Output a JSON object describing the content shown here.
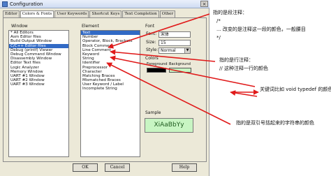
{
  "window": {
    "title": "Configuration",
    "close_label": "×"
  },
  "tabs": [
    "Editor",
    "Colors & Fonts",
    "User Keywords",
    "Shortcut Keys",
    "Text Completion",
    "Other"
  ],
  "window_group": {
    "label": "Window",
    "items": [
      "* All Editors",
      "Asm Editor files",
      "Build Output Window",
      "C/C++ Editor files",
      "Debug (printf) Viewer",
      "Debug Command Window",
      "Disassembly Window",
      "Editor Text files",
      "Logic Analyzer",
      "Memory Window",
      "UART #1 Window",
      "UART #2 Window",
      "UART #3 Window"
    ],
    "selected_index": 3
  },
  "element_group": {
    "label": "Element",
    "items": [
      "Text",
      "Number",
      "Operator, Block, Brackets",
      "Block Comment",
      "Line Comment",
      "Keyword",
      "String",
      "Identifier",
      "Preprocessor",
      "Character",
      "Matching Braces",
      "Mismatched Braces",
      "User Keyword / Label",
      "Incomplete String"
    ],
    "selected_index": 0
  },
  "font_group": {
    "label": "Font",
    "font_label": "Font:",
    "font_value": "宋体",
    "size_label": "Size:",
    "size_value": "15",
    "style_label": "Style:",
    "style_value": "Normal"
  },
  "colors_group": {
    "label": "Colors",
    "foreground_label": "Foreground",
    "background_label": "Background",
    "foreground_color": "#000000",
    "background_color": "#c8f5c3"
  },
  "sample": {
    "label": "Sample",
    "text": "XiAaBbYy"
  },
  "buttons": {
    "ok": "OK",
    "cancel": "Cancel",
    "help": "Help"
  },
  "annotations": {
    "a1_line1": "指的是段注释：",
    "a1_line2": "/*",
    "a1_line3": "... 改变的是注释这一段的颜色，一般腰目",
    "a1_line4": "*/",
    "a2_line1": "指的是行注释：",
    "a2_line2": "//   这种注释一行的颜色",
    "a3_line1": "关键词比如  void  typedef 的颜色改变",
    "a4_line1": "指的是双引号括起来的字符串的颜色"
  },
  "accent_color": "#e01a1a"
}
